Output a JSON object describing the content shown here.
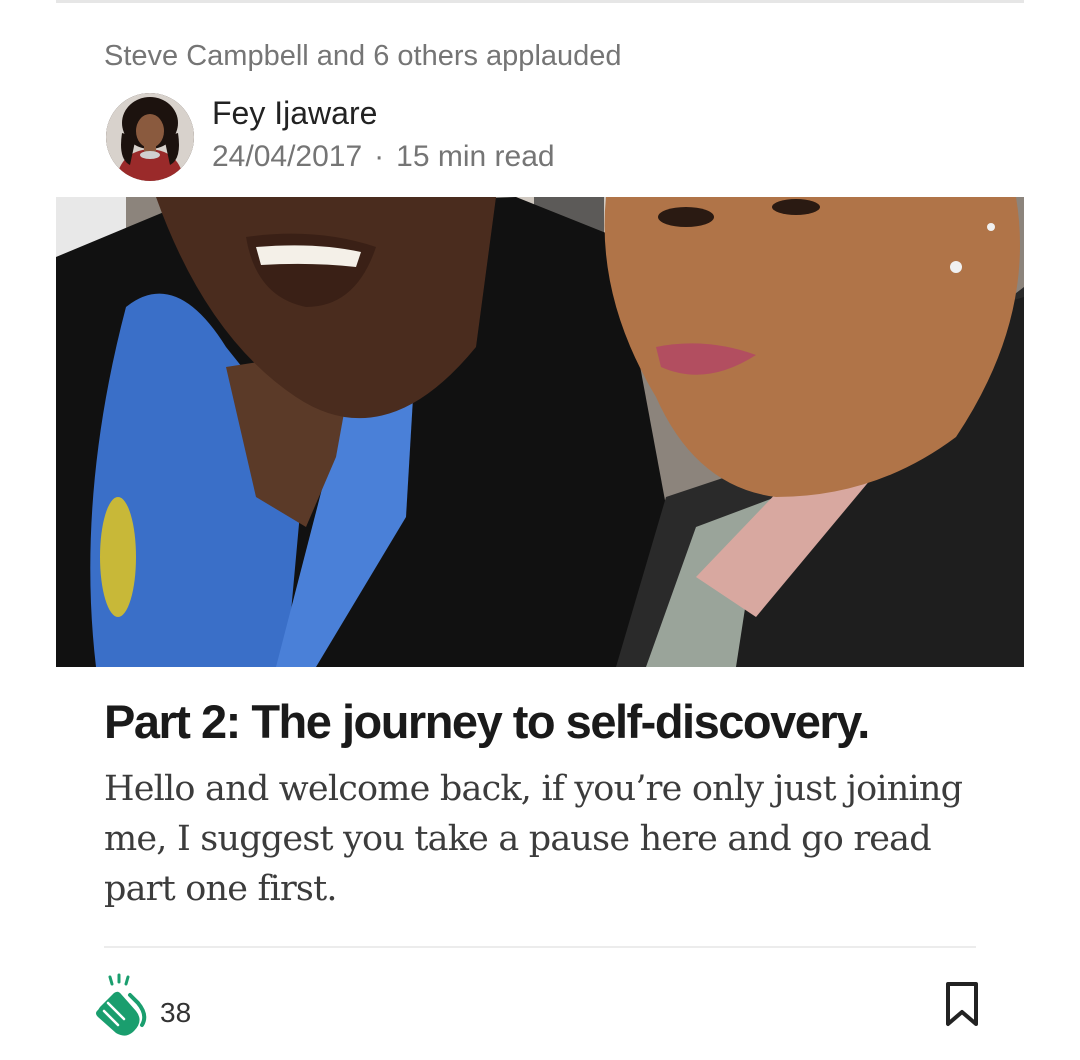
{
  "card": {
    "social_proof": "Steve Campbell and 6 others applauded",
    "author": {
      "name": "Fey Ijaware",
      "date": "24/04/2017",
      "read_time": "15 min read",
      "separator": "·"
    },
    "title": "Part 2: The journey to self-discovery.",
    "excerpt": "Hello and welcome back, if you’re only just joining me, I suggest you take a pause here and go read part one first.",
    "clap_count": "38"
  },
  "icons": {
    "clap": "clap-hands-icon",
    "bookmark": "bookmark-icon"
  },
  "colors": {
    "clap_green": "#1a9e6e",
    "text_dark": "#1a1a1a",
    "text_muted": "#757575"
  }
}
